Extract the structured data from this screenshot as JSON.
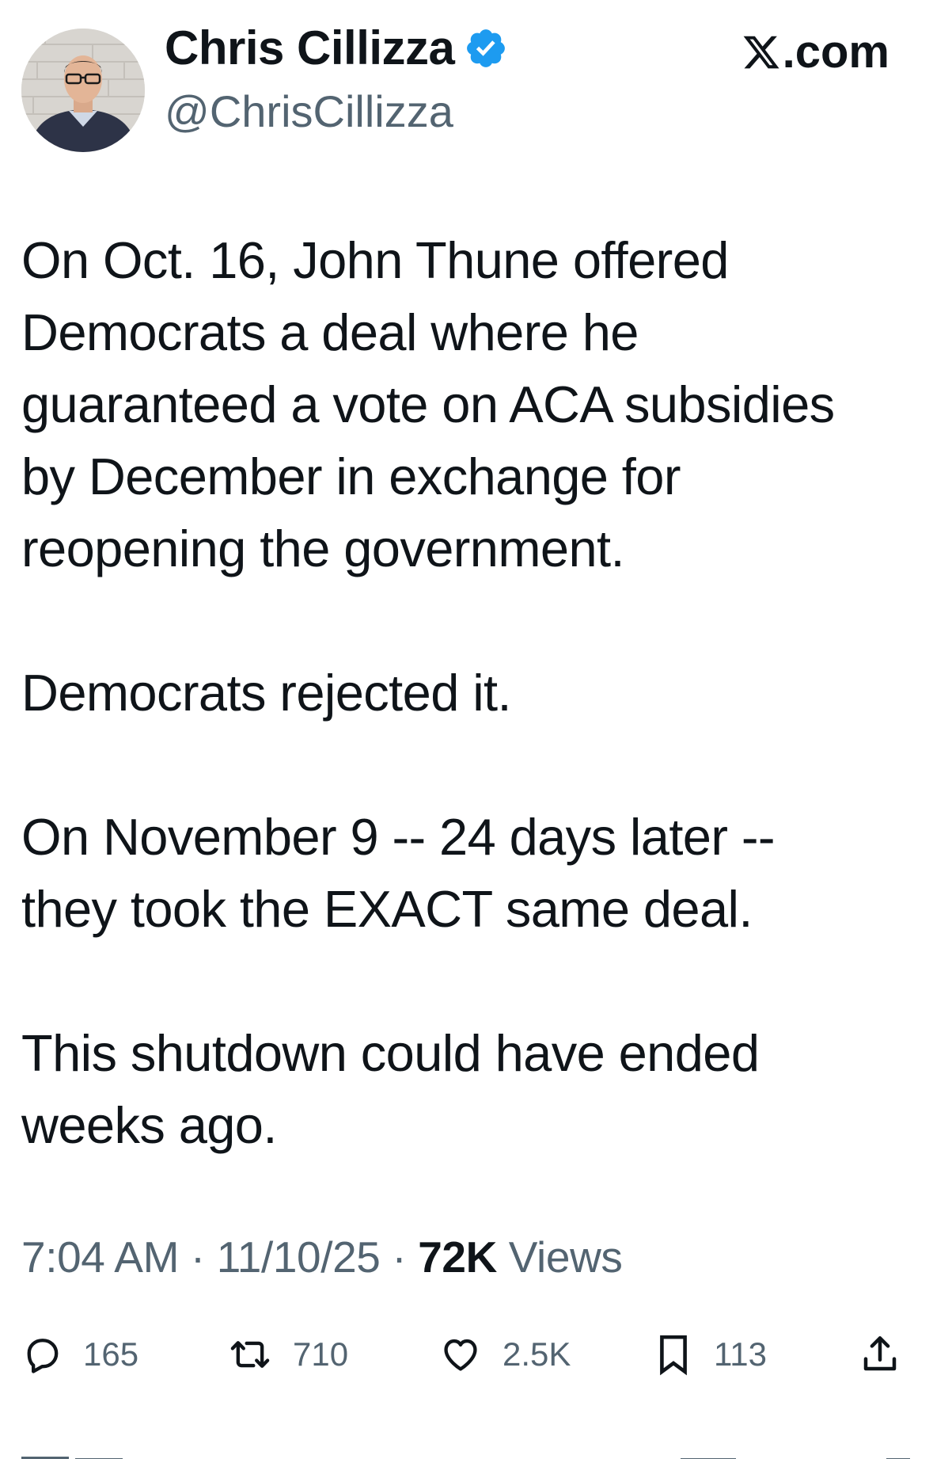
{
  "author": {
    "name": "Chris Cillizza",
    "handle": "@ChrisCillizza",
    "verified_icon": "verified-badge-icon",
    "verified_color": "#1d9bf0"
  },
  "brand": {
    "label": ".com",
    "icon": "x-logo-icon"
  },
  "tweet": {
    "paragraphs": [
      "On Oct. 16, John Thune offered\nDemocrats a deal where he\nguaranteed a vote on ACA subsidies\nby December in exchange for\nreopening the government.",
      "Democrats rejected it.",
      "On November 9 -- 24 days later --\nthey took the EXACT same deal.",
      "This shutdown could have ended\nweeks ago."
    ]
  },
  "meta": {
    "time": "7:04 AM",
    "separator": " · ",
    "date": "11/10/25",
    "views_count": "72K",
    "views_label": " Views"
  },
  "actions": {
    "replies": {
      "icon": "reply-icon",
      "count": "165"
    },
    "retweets": {
      "icon": "retweet-icon",
      "count": "710"
    },
    "likes": {
      "icon": "heart-icon",
      "count": "2.5K"
    },
    "bookmarks": {
      "icon": "bookmark-icon",
      "count": "113"
    },
    "share": {
      "icon": "share-icon"
    }
  },
  "colors": {
    "text_primary": "#0f1419",
    "text_secondary": "#536471",
    "background": "#ffffff"
  }
}
